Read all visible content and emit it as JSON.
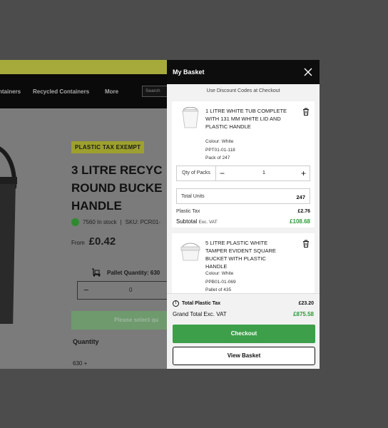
{
  "page": {
    "nav": {
      "item1": "ntainers",
      "item2": "Recycled Containers",
      "item3": "More",
      "search_placeholder": "Search"
    },
    "badge": "PLASTIC TAX EXEMPT",
    "title": "3 LITRE RECYC\nROUND BUCKE\nHANDLE",
    "stock": "7560 In stock",
    "sku": "SKU: PCR01-",
    "from_label": "From",
    "price": "£0.42",
    "pallet_label": "Pallet Quantity: 630",
    "qty_value": "0",
    "select_button": "Please select qu",
    "quantity_heading": "Quantity",
    "qty_row": "630 +"
  },
  "basket": {
    "title": "My Basket",
    "discount_note": "Use Discount Codes at Checkout",
    "items": [
      {
        "name": "1 LITRE WHITE TUB COMPLETE WITH 131 MM WHITE LID AND PLASTIC HANDLE",
        "colour": "Colour: White",
        "code": "PPT01-01-118",
        "pack": "Pack of 247",
        "qty_label": "Qty of Packs",
        "qty": "1",
        "total_units_label": "Total Units",
        "total_units": "247",
        "plastic_tax_label": "Plastic Tax",
        "plastic_tax": "£2.76",
        "subtotal_label": "Subtotal",
        "subtotal_suffix": "Exc. VAT",
        "subtotal": "£108.68"
      },
      {
        "name": "5 LITRE PLASTIC WHITE TAMPER EVIDENT SQUARE BUCKET WITH PLASTIC HANDLE",
        "colour": "Colour: White",
        "code": "PPB01-01-069",
        "pack": "Pallet of 435"
      }
    ],
    "total_tax_label": "Total Plastic Tax",
    "total_tax": "£23.20",
    "grand_total_label": "Grand Total Exc. VAT",
    "grand_total": "£875.58",
    "checkout_label": "Checkout",
    "view_basket_label": "View Basket"
  }
}
